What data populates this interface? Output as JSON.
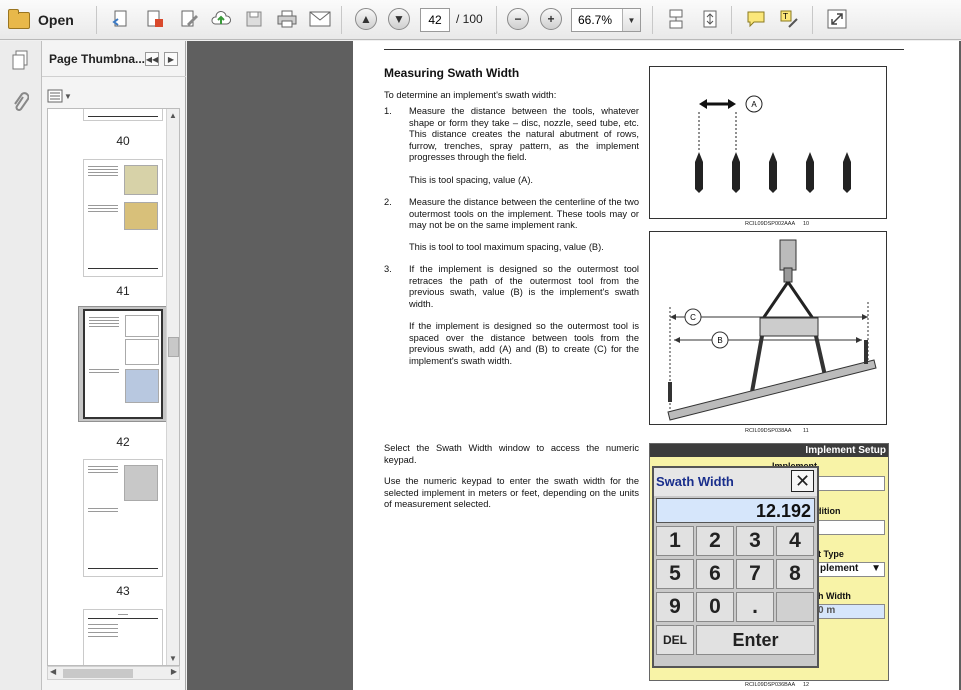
{
  "toolbar": {
    "open_label": "Open",
    "page_current": "42",
    "page_total": "/ 100",
    "zoom": "66.7%"
  },
  "sidebar": {
    "title": "Page Thumbna..."
  },
  "thumbnails": [
    {
      "label": "40"
    },
    {
      "label": "41"
    },
    {
      "label": "42"
    },
    {
      "label": "43"
    }
  ],
  "page": {
    "heading": "Measuring Swath Width",
    "intro": "To determine an implement's swath width:",
    "steps": [
      {
        "num": "1.",
        "text": "Measure the distance between the tools, whatever shape or form they take – disc, nozzle, seed tube, etc. This distance creates the natural abutment of rows, furrow, trenches, spray pattern, as the implement progresses through the field.",
        "note": "This is tool spacing, value (A)."
      },
      {
        "num": "2.",
        "text": "Measure the distance between the centerline of the two outermost tools on the implement. These tools may or may not be on the same implement rank.",
        "note": "This is tool to tool maximum spacing, value (B)."
      },
      {
        "num": "3.",
        "text": "If the implement is designed so the outermost tool retraces the path of the outermost tool from the previous swath, value (B) is the implement's swath width.",
        "note": "If the implement is designed so the outermost tool is spaced over the distance between tools from the previous swath, add (A) and (B) to create (C) for the implement's swath width."
      }
    ],
    "para_select": "Select the Swath Width window to access the numeric keypad.",
    "para_use": "Use the numeric keypad to enter the swath width for the selected implement in meters or feet, depending on the units of measurement selected.",
    "fig1": {
      "label_a": "A",
      "caption": "RCIL09DSP002AAA",
      "num": "10"
    },
    "fig2": {
      "label_b": "B",
      "label_c": "C",
      "caption": "RCIL09DSP038AA",
      "num": "11"
    },
    "fig3": {
      "caption": "RCIL09DSP036BAA",
      "num": "12"
    }
  },
  "keypad": {
    "header": "Implement Setup",
    "side_labels": [
      "Implement",
      "dition",
      "t Type",
      "plement",
      "h Width",
      "0 m"
    ],
    "title": "Swath Width",
    "display": "12.192",
    "keys": [
      "1",
      "2",
      "3",
      "4",
      "5",
      "6",
      "7",
      "8",
      "9",
      "0",
      "."
    ],
    "del": "DEL",
    "enter": "Enter"
  },
  "colors": {
    "toolbar_bg": "#eeeeee",
    "doc_bg": "#5f5f5f",
    "keypad_bg": "#f8f3a7",
    "keypad_title": "#1a2f8c",
    "display_bg": "#d6e6fb"
  }
}
